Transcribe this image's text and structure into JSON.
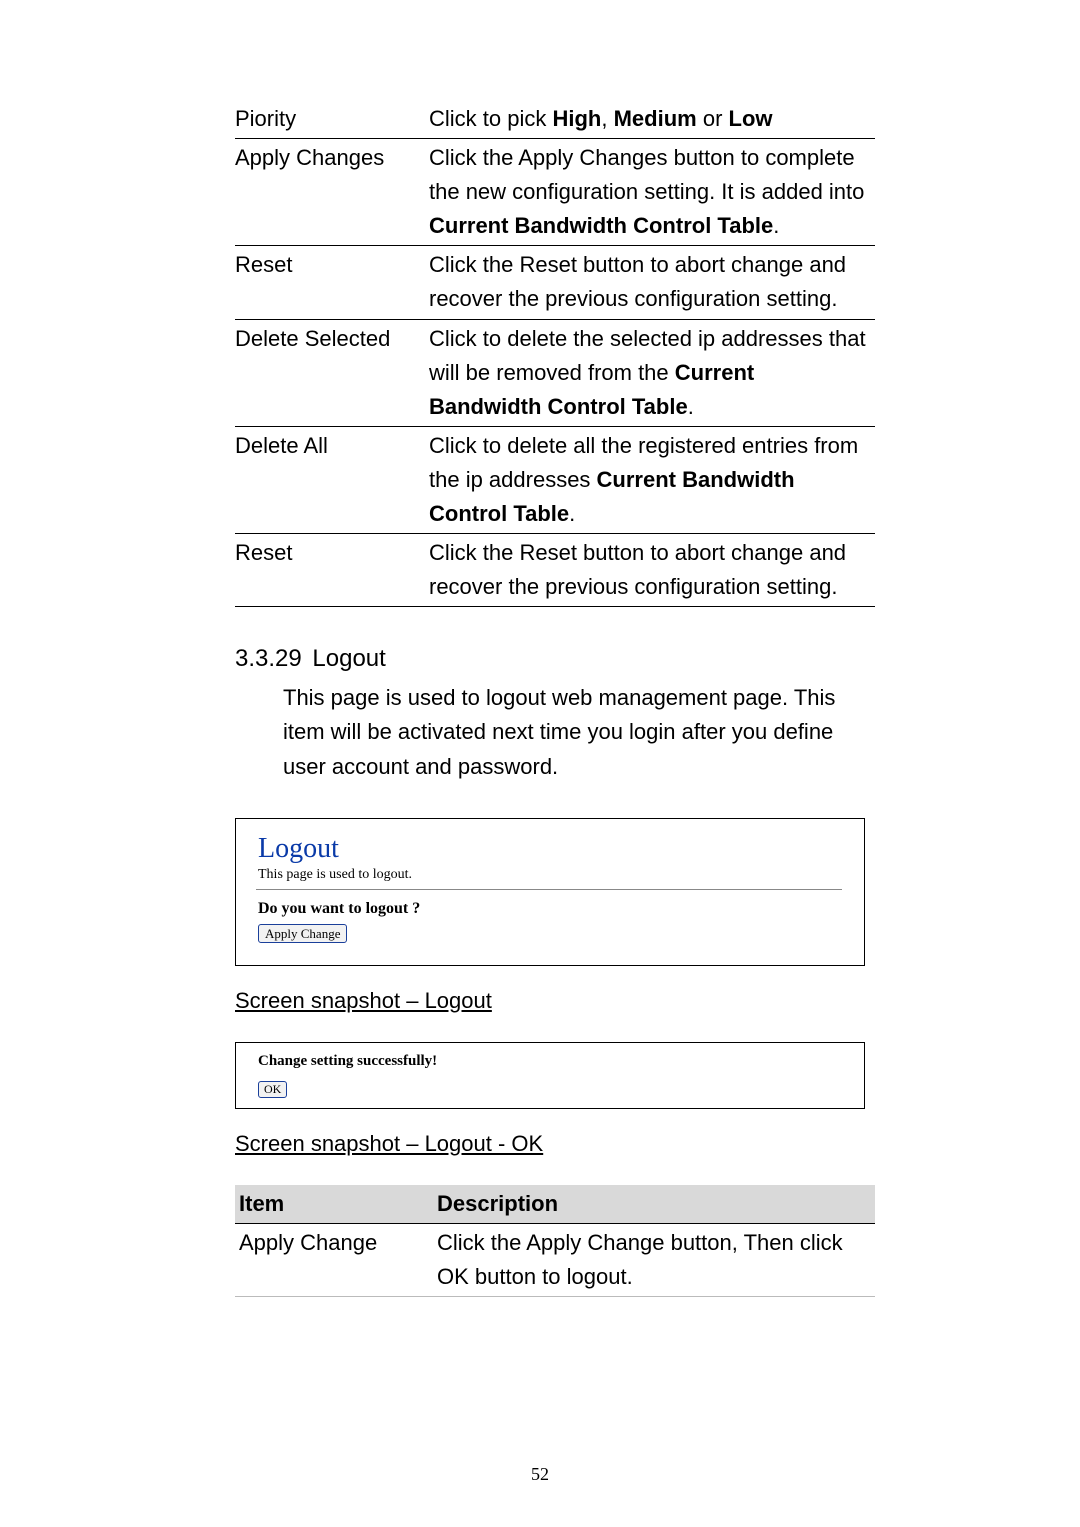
{
  "table1": {
    "rows": [
      {
        "item": "Piority",
        "desc_parts": [
          "Click to pick ",
          "High",
          ", ",
          "Medium",
          " or ",
          "Low"
        ],
        "bold_idx": [
          1,
          3,
          5
        ]
      },
      {
        "item": "Apply Changes",
        "desc_parts": [
          "Click the Apply Changes   button to complete the new configuration setting. It is added into ",
          "Current Bandwidth Control Table",
          "."
        ],
        "bold_idx": [
          1
        ]
      },
      {
        "item": "Reset",
        "desc_parts": [
          "Click the Reset button to abort change and recover the previous configuration setting."
        ],
        "bold_idx": []
      },
      {
        "item": "Delete Selected",
        "desc_parts": [
          "Click to delete the selected ip addresses that will be removed from the ",
          "Current Bandwidth Control Table",
          "."
        ],
        "bold_idx": [
          1
        ]
      },
      {
        "item": "Delete All",
        "desc_parts": [
          "Click to delete all the registered entries from the ip addresses ",
          "Current Bandwidth Control Table",
          "."
        ],
        "bold_idx": [
          1
        ]
      },
      {
        "item": "Reset",
        "desc_parts": [
          "Click the Reset button to abort change and recover the previous configuration setting."
        ],
        "bold_idx": []
      }
    ]
  },
  "section": {
    "number": "3.3.29",
    "title": "Logout",
    "body": "This page is used to logout web management page. This item will be activated next time you login after you define user account and password."
  },
  "panel_logout": {
    "title": "Logout",
    "sub": "This page is used to logout.",
    "question": "Do you want to logout ?",
    "button": "Apply Change"
  },
  "caption1": "Screen snapshot – Logout",
  "panel_success": {
    "text": "Change setting successfully!",
    "button": "OK"
  },
  "caption2": "Screen snapshot – Logout - OK",
  "table2": {
    "header_item": "Item",
    "header_desc": "Description",
    "rows": [
      {
        "item": "Apply Change",
        "desc": "Click the Apply Change  button, Then click OK button to logout."
      }
    ]
  },
  "page_number": "52"
}
